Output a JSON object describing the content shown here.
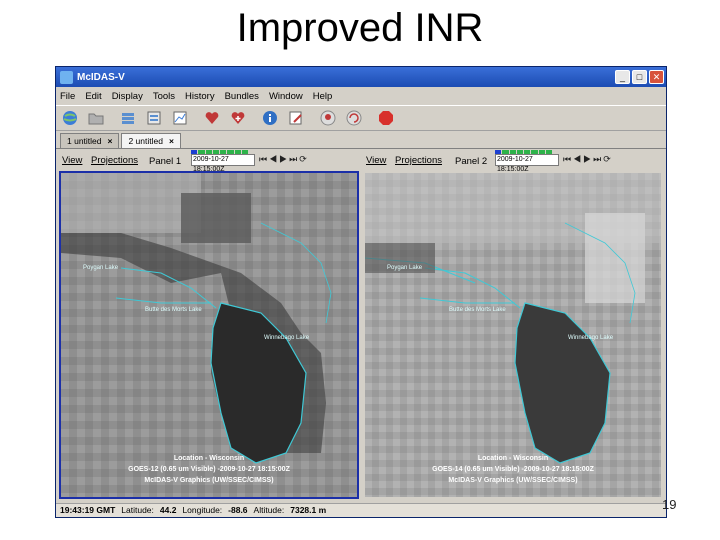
{
  "slide": {
    "title": "Improved INR",
    "page_number": "19"
  },
  "window": {
    "title": "McIDAS-V",
    "minimize": "_",
    "maximize": "□",
    "close": "✕"
  },
  "menu": [
    "File",
    "Edit",
    "Display",
    "Tools",
    "History",
    "Bundles",
    "Window",
    "Help"
  ],
  "tabs": [
    {
      "label": "1 untitled",
      "close": "×"
    },
    {
      "label": "2 untitled",
      "close": "×"
    }
  ],
  "panels": [
    {
      "view_menu": "View",
      "projections_menu": "Projections",
      "label": "Panel 1",
      "time": "2009-10-27 18:15:00Z",
      "labels": {
        "lake1": "Poygan Lake",
        "lake2": "Butte des Morts Lake",
        "lake3": "Winnebago Lake"
      },
      "caption": [
        "Location - Wisconsin",
        "GOES-12 (0.65 um Visible) -2009-10-27 18:15:00Z",
        "McIDAS-V Graphics (UW/SSEC/CIMSS)"
      ]
    },
    {
      "view_menu": "View",
      "projections_menu": "Projections",
      "label": "Panel 2",
      "time": "2009-10-27 18:15:00Z",
      "labels": {
        "lake1": "Poygan Lake",
        "lake2": "Butte des Morts Lake",
        "lake3": "Winnebago Lake"
      },
      "caption": [
        "Location - Wisconsin",
        "GOES-14 (0.65 um Visible) -2009-10-27 18:15:00Z",
        "McIDAS-V Graphics (UW/SSEC/CIMSS)"
      ]
    }
  ],
  "status": {
    "time": "19:43:19 GMT",
    "lat_label": "Latitude:",
    "lat": "44.2",
    "lon_label": "Longitude:",
    "lon": "-88.6",
    "alt_label": "Altitude:",
    "alt": "7328.1 m"
  },
  "icons": {
    "toolbar": [
      "globe-icon",
      "folder-icon",
      "stack-icon",
      "layers-icon",
      "chart-icon",
      "heart-icon",
      "heart-plus-icon",
      "info-icon",
      "edit-icon",
      "user-icon",
      "refresh-icon",
      "stop-icon"
    ]
  },
  "colors": {
    "accent": "#1b2fa8",
    "outline": "#3fc9d6",
    "stop": "#d8302b"
  }
}
